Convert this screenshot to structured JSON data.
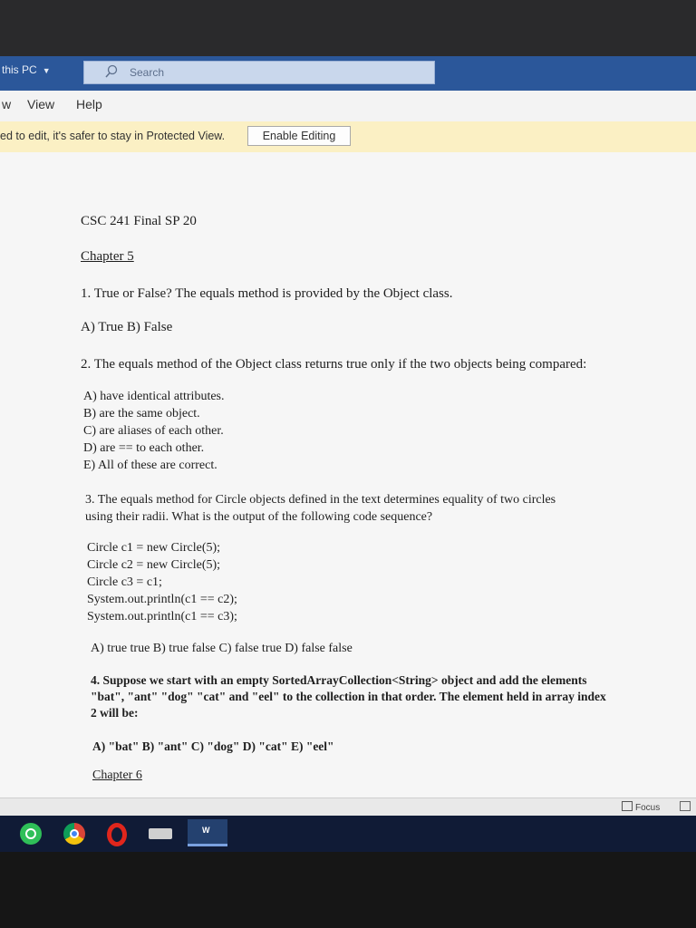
{
  "explorer": {
    "breadcrumb": "this PC",
    "search_placeholder": "Search"
  },
  "menu": {
    "partial": "w",
    "view": "View",
    "help": "Help"
  },
  "protected_view": {
    "message": "ed to edit, it's safer to stay in Protected View.",
    "button": "Enable Editing"
  },
  "document": {
    "title": "CSC 241 Final SP 20",
    "chapter5": "Chapter 5",
    "q1": {
      "text": "1. True or False? The equals method is provided by the Object class.",
      "options": "A) True   B) False"
    },
    "q2": {
      "text": "2. The equals method of the Object class returns true only if the two objects being compared:",
      "options": [
        "A) have identical attributes.",
        "B) are the same object.",
        "C) are aliases of each other.",
        "D) are == to each other.",
        "E) All of these are correct."
      ]
    },
    "q3": {
      "line1": "3. The equals method for Circle objects defined in the text determines equality of two circles",
      "line2": "using their radii. What is the output of the following code sequence?",
      "code": [
        "Circle c1 = new Circle(5);",
        "Circle c2 = new Circle(5);",
        "Circle c3 = c1;",
        "System.out.println(c1 == c2);",
        "System.out.println(c1 == c3);"
      ],
      "options": "A) true  true    B) true  false    C) false  true     D) false  false"
    },
    "q4": {
      "line1": "4. Suppose we start with an empty SortedArrayCollection<String> object and add the elements",
      "line2": "\"bat\", \"ant\" \"dog\" \"cat\" and \"eel\" to the collection in that order. The element held in array index",
      "line3": "2 will be:",
      "options": "A) \"bat\"    B) \"ant\"   C) \"dog\"   D) \"cat\"    E) \"eel\""
    },
    "chapter6": "Chapter 6"
  },
  "status": {
    "focus": "Focus"
  },
  "taskbar": {
    "word_label": "W"
  }
}
